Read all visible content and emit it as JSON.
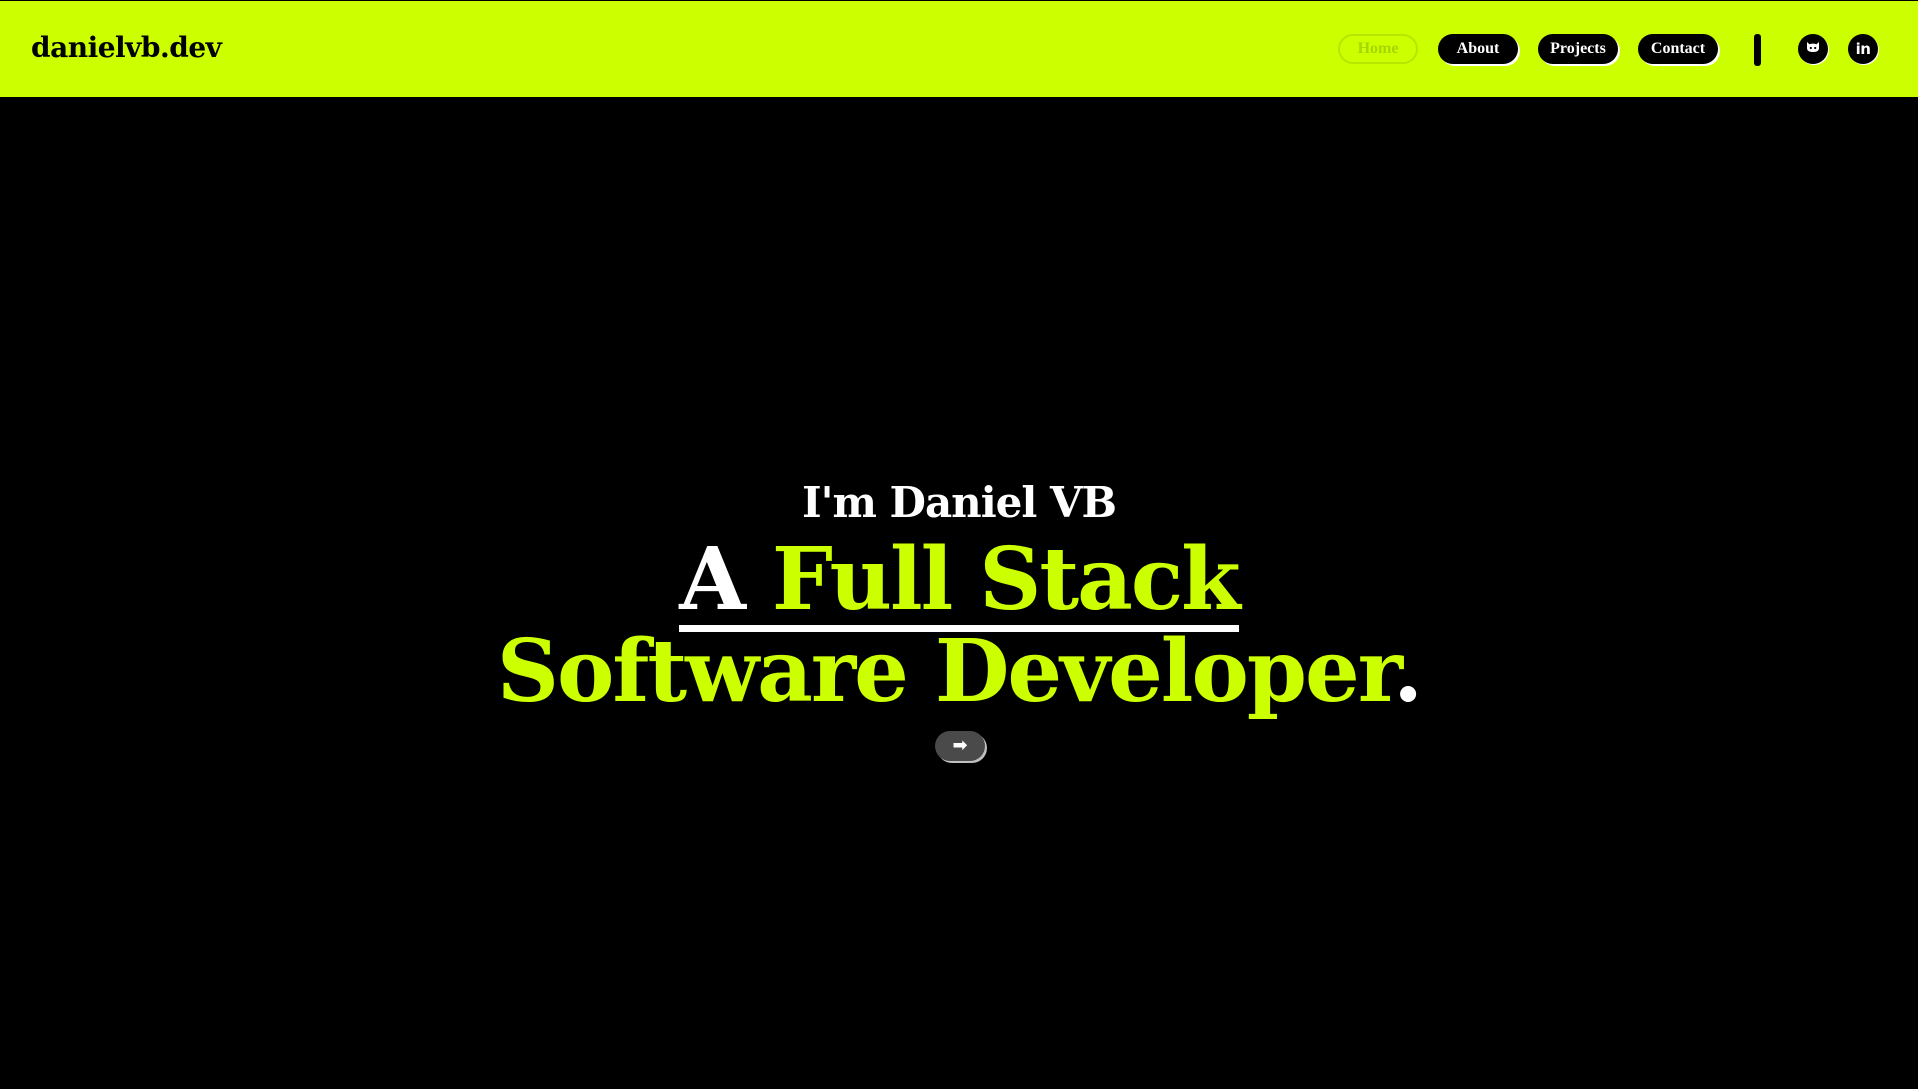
{
  "header": {
    "brand": "danielvb.dev",
    "nav": [
      {
        "label": "Home",
        "active": true
      },
      {
        "label": "About",
        "active": false
      },
      {
        "label": "Projects",
        "active": false
      },
      {
        "label": "Contact",
        "active": false
      }
    ],
    "social": [
      {
        "icon": "github-icon"
      },
      {
        "icon": "linkedin-icon",
        "glyph": "in"
      }
    ]
  },
  "hero": {
    "intro": "I'm Daniel VB",
    "line1_prefix": "A",
    "line1_highlight": "Full Stack",
    "line2_highlight": "Software Developer",
    "line2_period": ".",
    "cta_glyph": "➡"
  },
  "colors": {
    "accent": "#ccff00",
    "background": "#000000",
    "text": "#ffffff"
  }
}
